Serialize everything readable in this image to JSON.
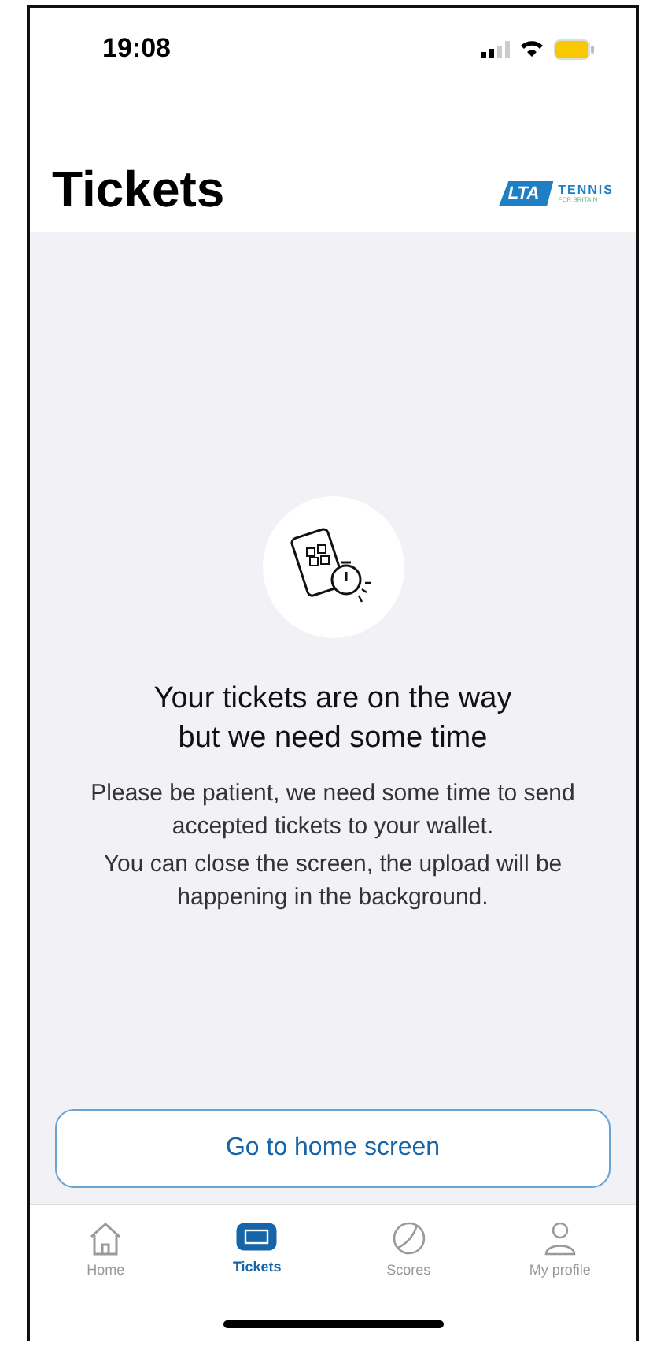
{
  "status_bar": {
    "time": "19:08"
  },
  "header": {
    "title": "Tickets",
    "logo": {
      "mark": "LTA",
      "line_1": "TENNIS",
      "line_2": "FOR BRITAIN"
    }
  },
  "message": {
    "title": "Your tickets are on the way\nbut we need some time",
    "paragraphs": [
      "Please be patient, we need some time to send accepted tickets to your wallet.",
      "You can close the screen, the upload will be happening in the background."
    ]
  },
  "button": {
    "label": "Go to home screen"
  },
  "tab_bar": [
    {
      "kind": "home",
      "label": "Home",
      "selected": false
    },
    {
      "kind": "tickets",
      "label": "Tickets",
      "selected": true
    },
    {
      "kind": "scores",
      "label": "Scores",
      "selected": false
    },
    {
      "kind": "profile",
      "label": "My profile",
      "selected": false
    }
  ]
}
